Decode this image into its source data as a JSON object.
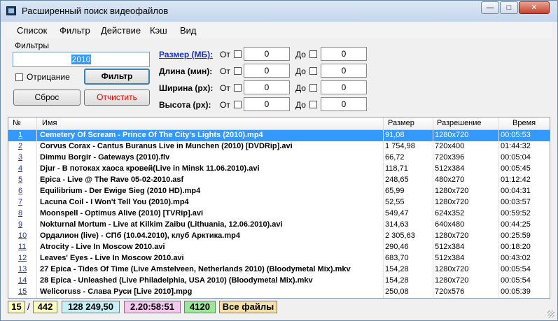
{
  "window": {
    "title": "Расширенный поиск видеофайлов",
    "min": "—",
    "max": "□",
    "close": "✕"
  },
  "menu": [
    "Список",
    "Фильтр",
    "Действие",
    "Кэш",
    "Вид"
  ],
  "filters": {
    "label": "Фильтры",
    "search_value": "2010",
    "negation_label": "Отрицание",
    "filter_button": "Фильтр",
    "reset_button": "Сброс",
    "clear_button": "Отчистить"
  },
  "ranges": [
    {
      "label": "Размер (МБ):",
      "from_label": "От",
      "from": "0",
      "to_label": "До",
      "to": "0"
    },
    {
      "label": "Длина (мин):",
      "from_label": "От",
      "from": "0",
      "to_label": "До",
      "to": "0"
    },
    {
      "label": "Ширина (px):",
      "from_label": "От",
      "from": "0",
      "to_label": "До",
      "to": "0"
    },
    {
      "label": "Высота (px):",
      "from_label": "От",
      "from": "0",
      "to_label": "До",
      "to": "0"
    }
  ],
  "table": {
    "columns": [
      "№",
      "Имя",
      "Размер",
      "Разрешение",
      "Время"
    ],
    "rows": [
      [
        "1",
        "Cemetery Of Scream - Prince Of The City's Lights (2010).mp4",
        "91,08",
        "1280x720",
        "00:05:53"
      ],
      [
        "2",
        "Corvus Corax - Cantus Buranus Live in Munchen (2010) [DVDRip].avi",
        "1 754,98",
        "720x400",
        "01:44:32"
      ],
      [
        "3",
        "Dimmu Borgir - Gateways (2010).flv",
        "66,72",
        "720x396",
        "00:05:04"
      ],
      [
        "4",
        "Djur - В потоках хаоса кровей(Live in Minsk 11.06.2010).avi",
        "118,71",
        "512x384",
        "00:05:45"
      ],
      [
        "5",
        "Epica - Live @ The Rave 05-02-2010.asf",
        "248,65",
        "480x270",
        "01:12:42"
      ],
      [
        "6",
        "Equilibrium - Der Ewige Sieg (2010 HD).mp4",
        "65,99",
        "1280x720",
        "00:04:31"
      ],
      [
        "7",
        "Lacuna Coil - I Won't Tell You (2010).mp4",
        "52,55",
        "1280x720",
        "00:03:57"
      ],
      [
        "8",
        "Moonspell - Optimus  Alive (2010) [TVRip].avi",
        "549,47",
        "624x352",
        "00:59:52"
      ],
      [
        "9",
        "Nokturnal Mortum - Live at Kilkim Zaibu (Lithuania, 12.06.2010).avi",
        "314,63",
        "640x480",
        "00:44:25"
      ],
      [
        "10",
        "Ордалион (live) - СПб (10.04.2010), клуб Арктика.mp4",
        "2 305,63",
        "1280x720",
        "00:25:59"
      ],
      [
        "11",
        "Atrocity - Live In Moscow 2010.avi",
        "290,46",
        "512x384",
        "00:18:20"
      ],
      [
        "12",
        "Leaves' Eyes - Live In Moscow 2010.avi",
        "683,70",
        "512x384",
        "00:43:02"
      ],
      [
        "13",
        "27 Epica - Tides Of Time (Live Amstelveen, Netherlands 2010) (Bloodymetal Mix).mkv",
        "154,28",
        "1280x720",
        "00:05:54"
      ],
      [
        "14",
        "28 Epica - Unleashed (Live Philadelphia, USA 2010) (Bloodymetal Mix).mkv",
        "154,28",
        "1280x720",
        "00:05:54"
      ],
      [
        "15",
        "Welicoruss - Слава Руси [Live 2010].mpg",
        "250,08",
        "720x576",
        "00:05:39"
      ]
    ]
  },
  "status": {
    "shown": "15",
    "separator": "/",
    "total": "442",
    "size": "128 249,50",
    "duration": "2.20:58:51",
    "count": "4120",
    "mode": "Все файлы"
  }
}
